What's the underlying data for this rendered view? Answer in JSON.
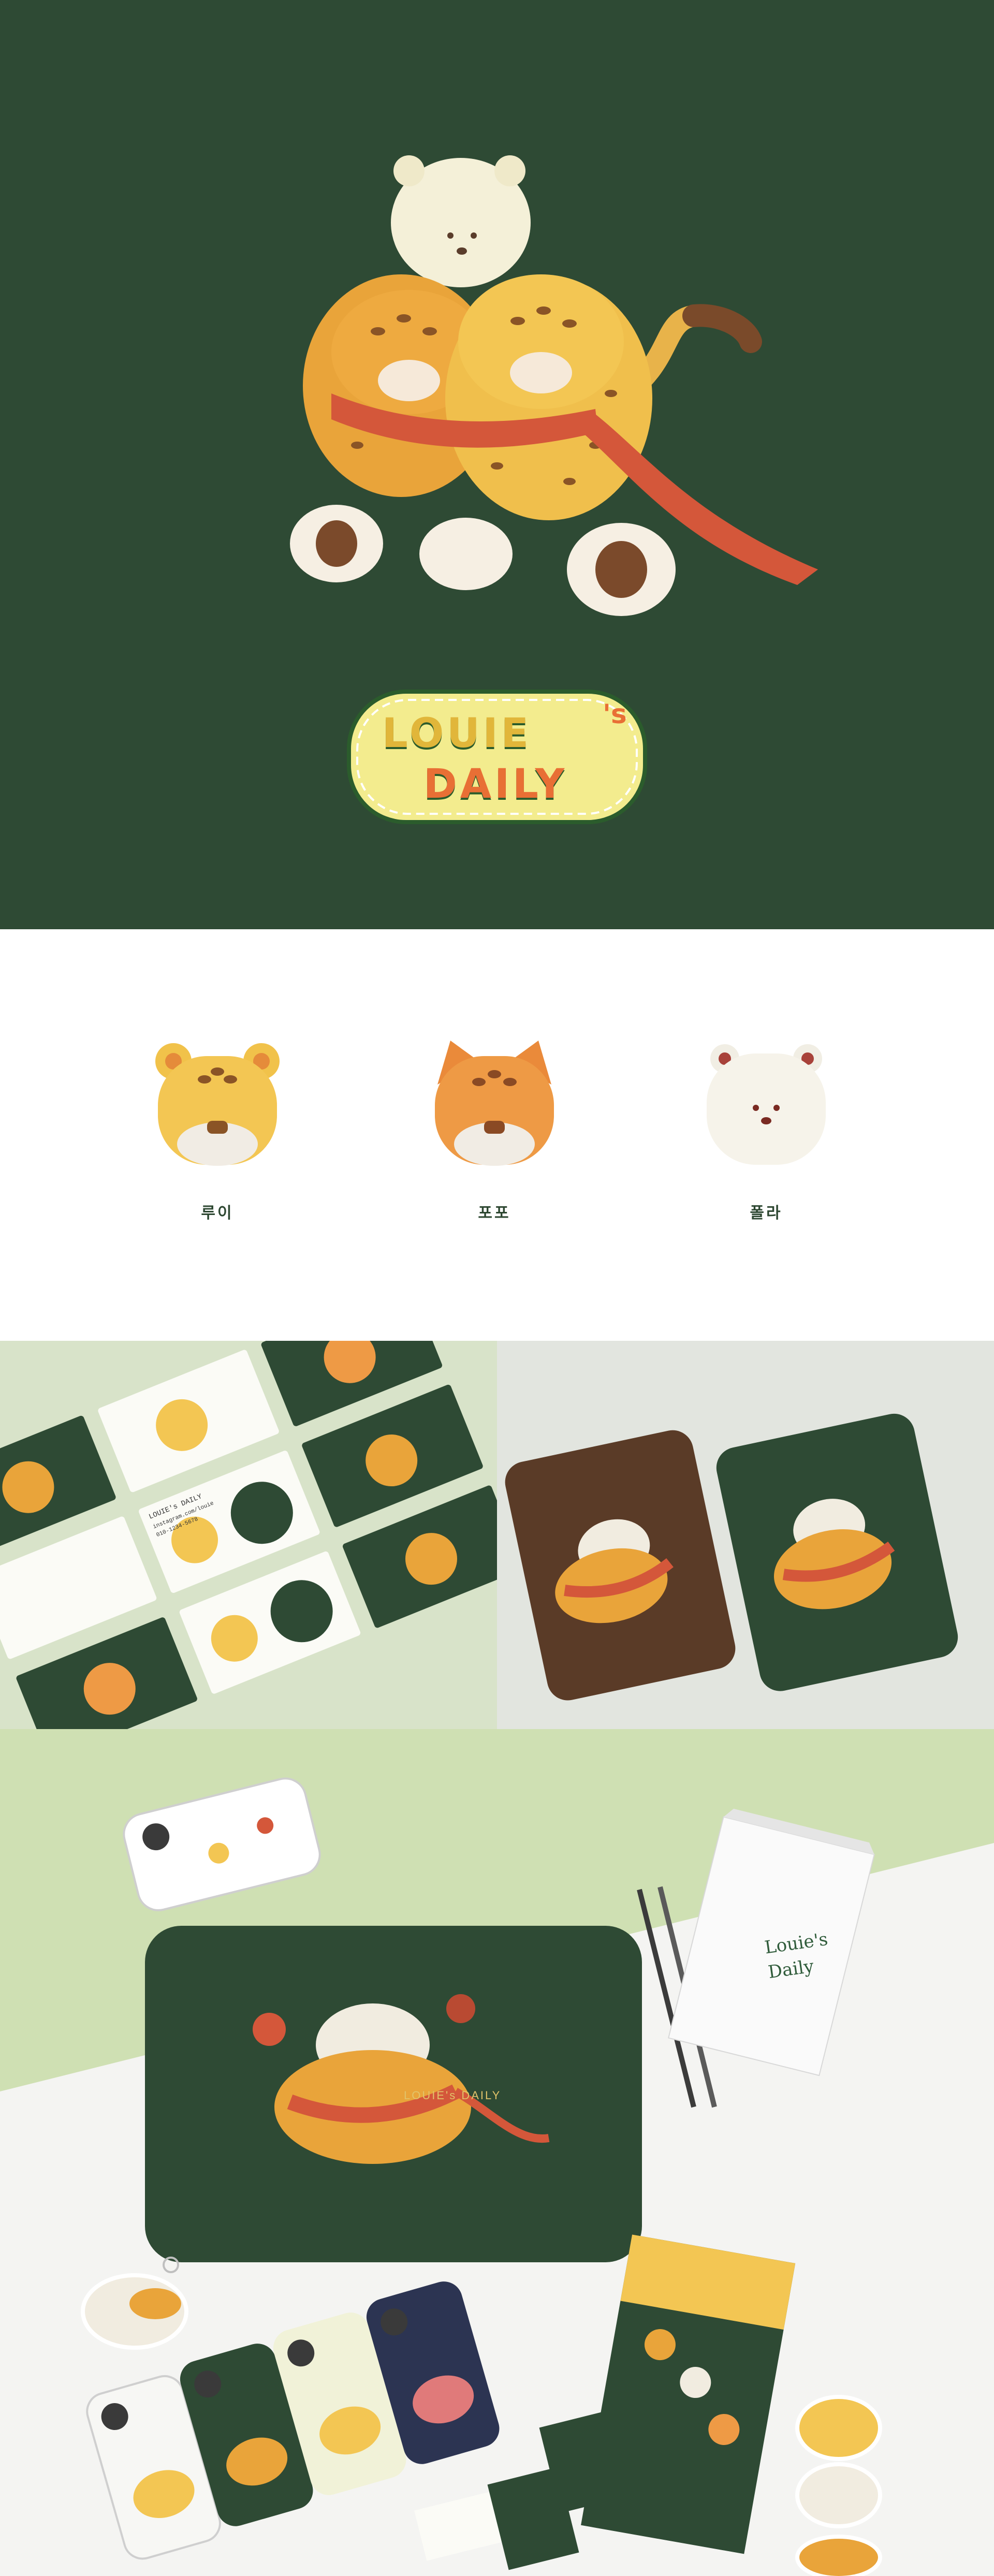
{
  "brand": {
    "logo_line1": "LOUIE",
    "logo_apostrophe": "'s",
    "logo_line2": "DAILY",
    "sleeve_logo": "LOUIE's DAILY",
    "notebook_text_line1": "Louie's",
    "notebook_text_line2": "Daily"
  },
  "characters": [
    {
      "name": "루이",
      "icon": "yellow-leopard-icon"
    },
    {
      "name": "포포",
      "icon": "orange-leopard-icon"
    },
    {
      "name": "폴라",
      "icon": "polar-bear-icon"
    }
  ],
  "business_card": {
    "title": "LOUIE's DAILY",
    "line1": "instagram.com/louie",
    "line2": "010-1234-5678"
  },
  "colors": {
    "hero_bg": "#2e4a34",
    "brand_green": "#2d4731",
    "yellow": "#f1c24a",
    "orange": "#e98a3c",
    "scarf": "#d4573a"
  }
}
